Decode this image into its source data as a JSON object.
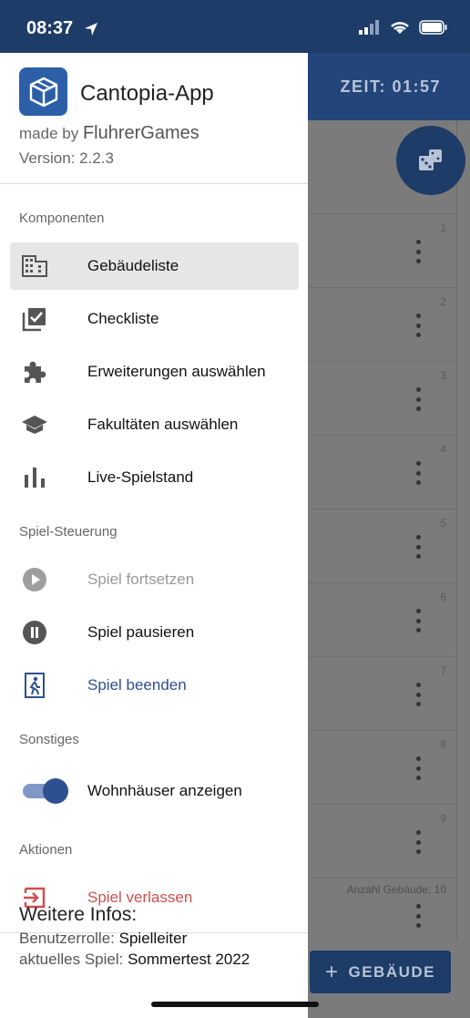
{
  "status_bar": {
    "time": "08:37"
  },
  "app_bar": {
    "timer": "ZEIT: 01:57"
  },
  "background_list": {
    "rows": [
      "1",
      "2",
      "3",
      "4",
      "5",
      "6",
      "7",
      "8",
      "9"
    ],
    "count_label": "Anzahl Gebäude: 10",
    "add_button_label": "GEBÄUDE"
  },
  "drawer": {
    "app_name": "Cantopia-App",
    "made_by_prefix": "made by",
    "made_by_name": "FluhrerGames",
    "version": "Version: 2.2.3",
    "sections": {
      "komponenten": "Komponenten",
      "steuerung": "Spiel-Steuerung",
      "sonstiges": "Sonstiges",
      "aktionen": "Aktionen"
    },
    "items": {
      "gebaeudeliste": "Gebäudeliste",
      "checkliste": "Checkliste",
      "erweiterungen": "Erweiterungen auswählen",
      "fakultaeten": "Fakultäten auswählen",
      "live": "Live-Spielstand",
      "fortsetzen": "Spiel fortsetzen",
      "pausieren": "Spiel pausieren",
      "beenden": "Spiel beenden",
      "wohnhaeuser": "Wohnhäuser anzeigen",
      "verlassen": "Spiel verlassen"
    },
    "wohnhaeuser_enabled": true,
    "info": {
      "title": "Weitere Infos:",
      "role_label": "Benutzerrolle:",
      "role_value": "Spielleiter",
      "game_label": "aktuelles Spiel:",
      "game_value": "Sommertest 2022"
    }
  },
  "colors": {
    "primary": "#23457a",
    "accent_blue": "#2d5091",
    "danger": "#d04f4f"
  }
}
